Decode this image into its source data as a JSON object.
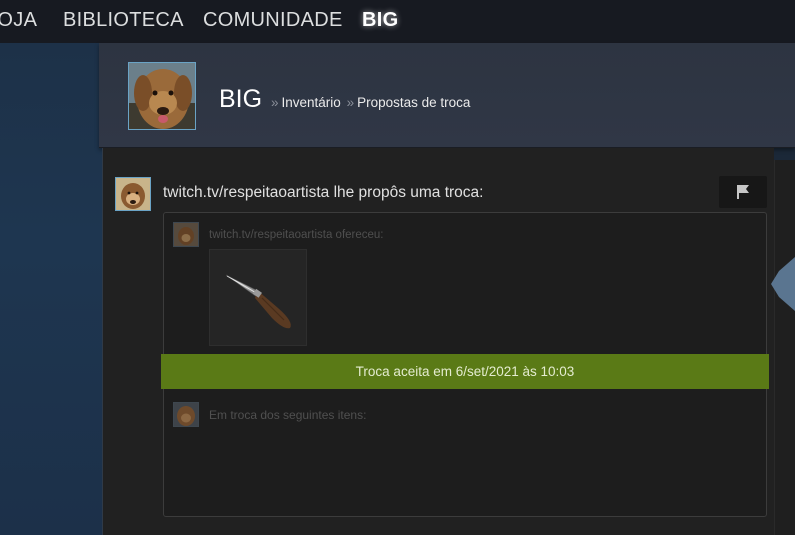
{
  "nav": {
    "loja": "LOJA",
    "biblioteca": "BIBLIOTECA",
    "comunidade": "COMUNIDADE",
    "user": "BIG"
  },
  "profile": {
    "name": "BIG",
    "breadcrumb": {
      "separator": "»",
      "inventory": "Inventário",
      "offers": "Propostas de troca"
    }
  },
  "offer": {
    "title": "twitch.tv/respeitaoartista lhe propôs uma troca:",
    "offered_label": "twitch.tv/respeitaoartista ofereceu:",
    "item_icon": "knife-icon",
    "status": "Troca aceita em 6/set/2021 às 10:03",
    "received_label": "Em troca dos seguintes itens:",
    "report_icon": "flag-icon"
  },
  "colors": {
    "nav_bg": "#171a21",
    "accepted_green": "#5a7a16",
    "avatar_border": "#6aa3c5"
  }
}
